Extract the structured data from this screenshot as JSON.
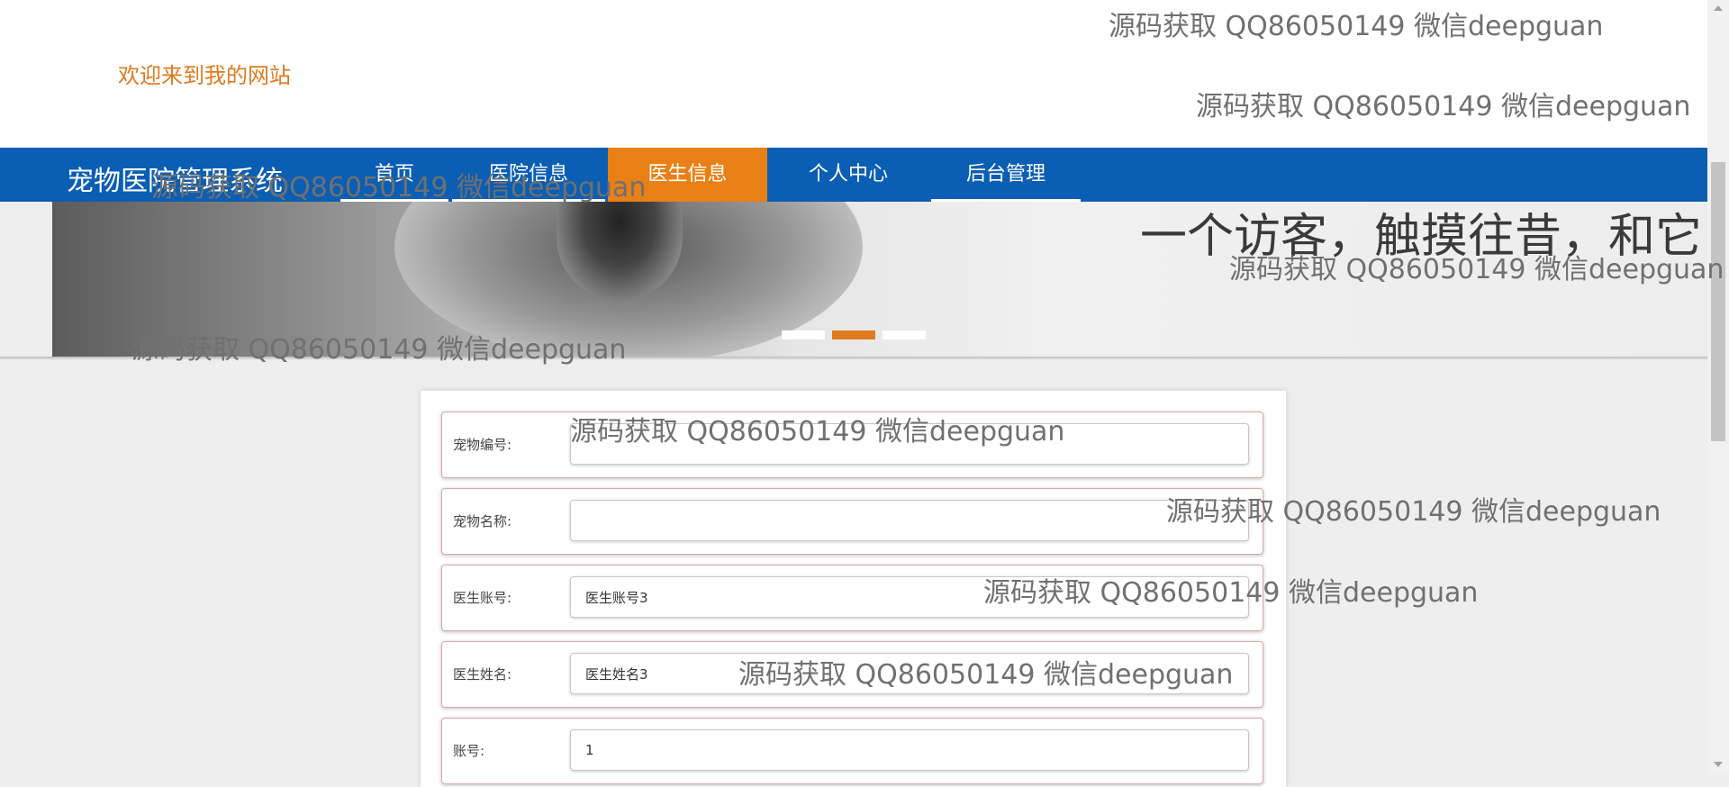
{
  "header": {
    "welcome": "欢迎来到我的网站"
  },
  "nav": {
    "brand": "宠物医院管理系统",
    "items": [
      {
        "label": "首页"
      },
      {
        "label": "医院信息"
      },
      {
        "label": "医生信息"
      },
      {
        "label": "个人中心"
      },
      {
        "label": "后台管理"
      }
    ],
    "active_index": 2
  },
  "banner": {
    "text": "一个访客，触摸往昔，和它",
    "slides": 3,
    "active_slide": 1
  },
  "form": {
    "fields": [
      {
        "label": "宠物编号:",
        "value": ""
      },
      {
        "label": "宠物名称:",
        "value": ""
      },
      {
        "label": "医生账号:",
        "value": "医生账号3"
      },
      {
        "label": "医生姓名:",
        "value": "医生姓名3"
      },
      {
        "label": "账号:",
        "value": "1"
      }
    ]
  },
  "watermark": "源码获取 QQ86050149 微信deepguan",
  "colors": {
    "nav_bg": "#0a5eb3",
    "accent": "#e88015",
    "welcome": "#e07a1f"
  }
}
